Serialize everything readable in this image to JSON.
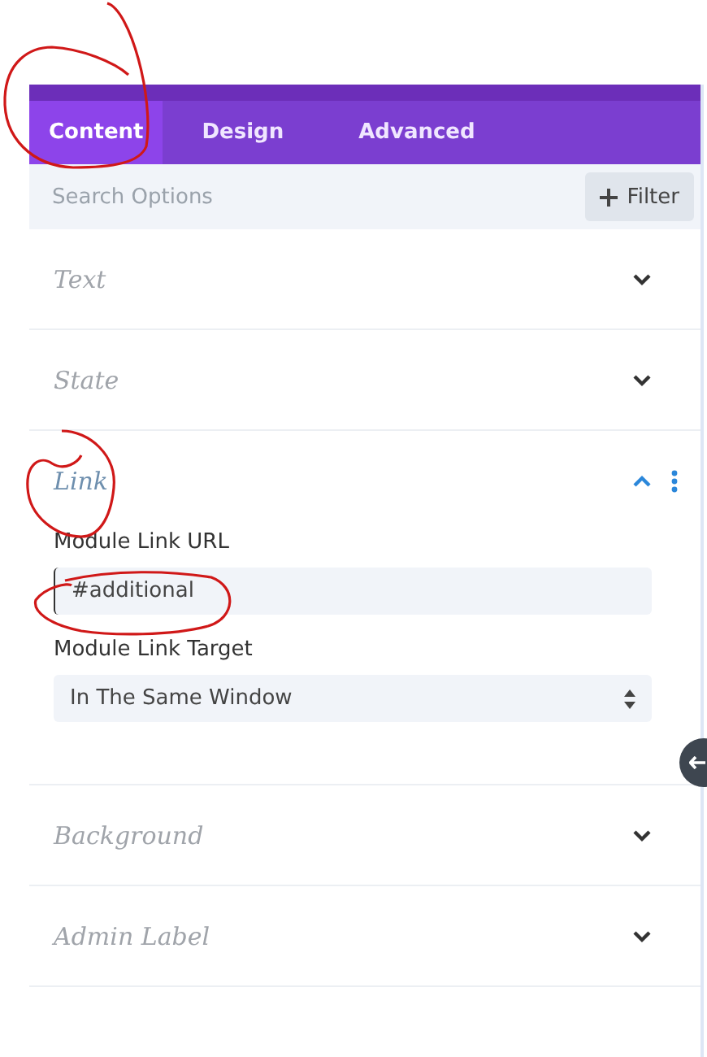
{
  "tabs": [
    {
      "label": "Content",
      "selected": true
    },
    {
      "label": "Design",
      "selected": false
    },
    {
      "label": "Advanced",
      "selected": false
    }
  ],
  "search": {
    "placeholder": "Search Options"
  },
  "filter_button": {
    "label": "Filter"
  },
  "sections": [
    {
      "title": "Text",
      "expanded": false
    },
    {
      "title": "State",
      "expanded": false
    },
    {
      "title": "Link",
      "expanded": true,
      "fields": [
        {
          "kind": "text",
          "label": "Module Link URL",
          "value": "#additional"
        },
        {
          "kind": "select",
          "label": "Module Link Target",
          "value": "In The Same Window"
        }
      ]
    },
    {
      "title": "Background",
      "expanded": false
    },
    {
      "title": "Admin Label",
      "expanded": false
    }
  ]
}
